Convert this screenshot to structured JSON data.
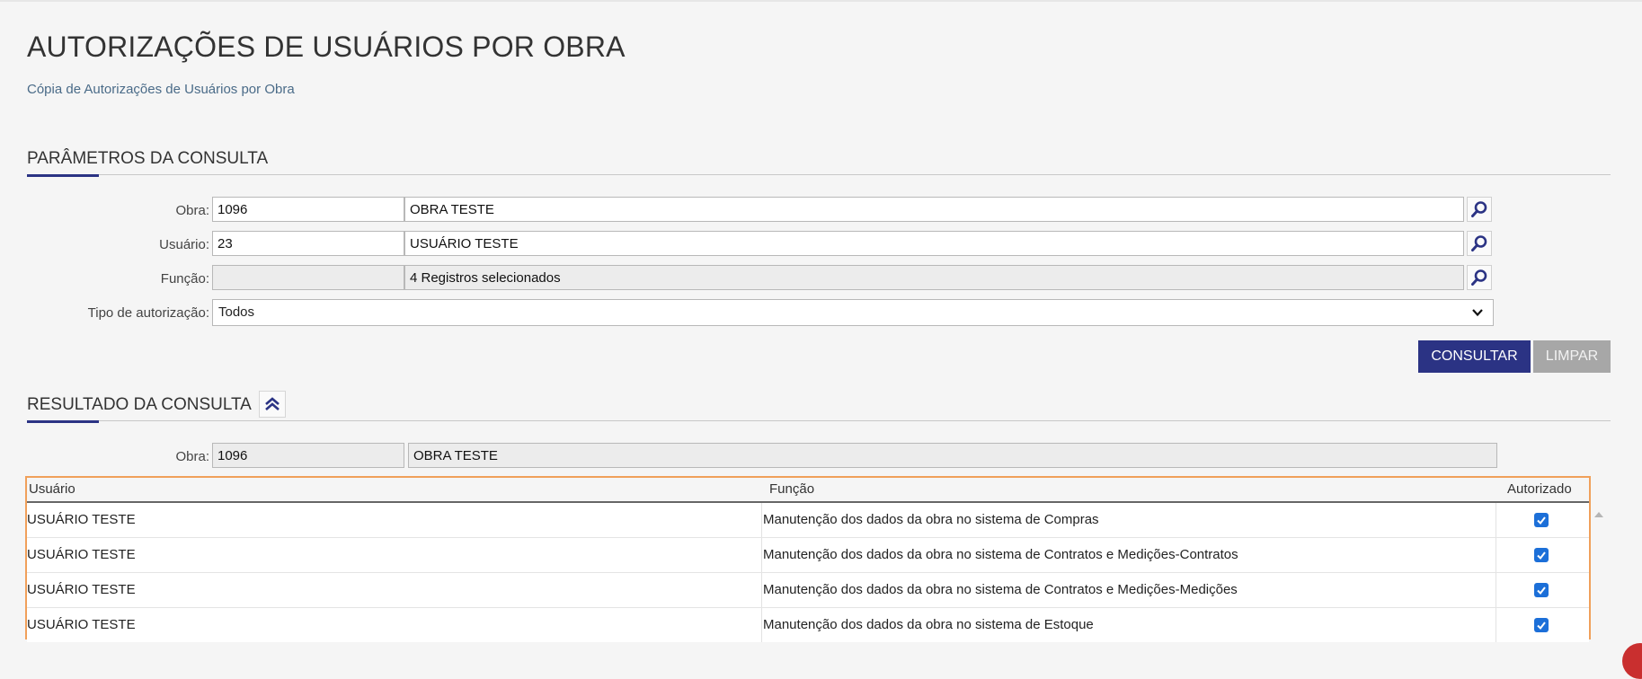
{
  "page": {
    "title": "AUTORIZAÇÕES DE USUÁRIOS POR OBRA",
    "subtitle_link": "Cópia de Autorizações de Usuários por Obra"
  },
  "params": {
    "section_title": "PARÂMETROS DA CONSULTA",
    "obra": {
      "label": "Obra:",
      "code": "1096",
      "name": "OBRA TESTE"
    },
    "usuario": {
      "label": "Usuário:",
      "code": "23",
      "name": "USUÁRIO TESTE"
    },
    "funcao": {
      "label": "Função:",
      "code": "",
      "name": "4 Registros selecionados"
    },
    "tipo": {
      "label": "Tipo de autorização:",
      "value": "Todos"
    },
    "consultar_label": "CONSULTAR",
    "limpar_label": "LIMPAR"
  },
  "result": {
    "section_title": "RESULTADO DA CONSULTA",
    "obra": {
      "label": "Obra:",
      "code": "1096",
      "name": "OBRA TESTE"
    },
    "columns": {
      "usuario": "Usuário",
      "funcao": "Função",
      "autorizado": "Autorizado"
    },
    "rows": [
      {
        "usuario": "USUÁRIO TESTE",
        "funcao": "Manutenção dos dados da obra no sistema de Compras",
        "autorizado": true
      },
      {
        "usuario": "USUÁRIO TESTE",
        "funcao": "Manutenção dos dados da obra no sistema de Contratos e Medições-Contratos",
        "autorizado": true
      },
      {
        "usuario": "USUÁRIO TESTE",
        "funcao": "Manutenção dos dados da obra no sistema de Contratos e Medições-Medições",
        "autorizado": true
      },
      {
        "usuario": "USUÁRIO TESTE",
        "funcao": "Manutenção dos dados da obra no sistema de Estoque",
        "autorizado": true
      }
    ]
  },
  "colors": {
    "primary": "#2b3384",
    "highlight_border": "#f0a05a",
    "checkbox": "#1c6fd8"
  },
  "icons": {
    "lookup": "magnifier-icon",
    "collapse": "double-chevron-up-icon",
    "select": "chevron-down-icon"
  }
}
